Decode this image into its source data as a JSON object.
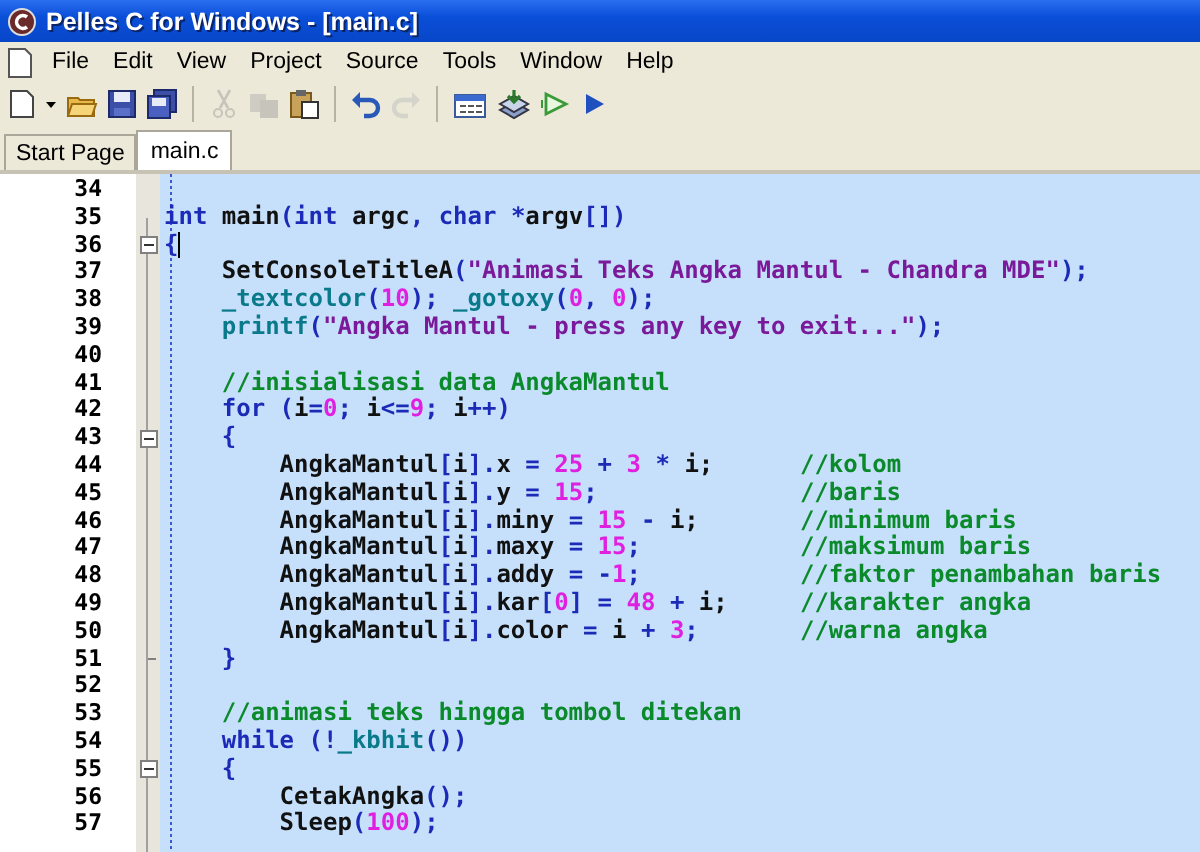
{
  "window": {
    "title": "Pelles C for Windows - [main.c]"
  },
  "menu": [
    {
      "label": "File"
    },
    {
      "label": "Edit"
    },
    {
      "label": "View"
    },
    {
      "label": "Project"
    },
    {
      "label": "Source"
    },
    {
      "label": "Tools"
    },
    {
      "label": "Window"
    },
    {
      "label": "Help"
    }
  ],
  "toolbar": [
    {
      "kind": "new",
      "disabled": false
    },
    {
      "kind": "dropdown",
      "disabled": false
    },
    {
      "kind": "open",
      "disabled": false
    },
    {
      "kind": "save",
      "disabled": false
    },
    {
      "kind": "saveall",
      "disabled": false
    },
    {
      "kind": "sep"
    },
    {
      "kind": "cut",
      "disabled": true
    },
    {
      "kind": "copy",
      "disabled": true
    },
    {
      "kind": "paste",
      "disabled": false
    },
    {
      "kind": "sep"
    },
    {
      "kind": "undo",
      "disabled": false
    },
    {
      "kind": "redo",
      "disabled": true
    },
    {
      "kind": "sep"
    },
    {
      "kind": "compile",
      "disabled": false
    },
    {
      "kind": "build",
      "disabled": false
    },
    {
      "kind": "run",
      "disabled": false
    },
    {
      "kind": "go",
      "disabled": false
    }
  ],
  "tabs": [
    {
      "label": "Start Page",
      "selected": false
    },
    {
      "label": "main.c",
      "selected": true
    }
  ],
  "editor": {
    "lines": [
      {
        "number": "34",
        "fold_start": false,
        "fold_end": false,
        "caret": false
      },
      {
        "number": "35",
        "fold_start": false,
        "fold_end": false,
        "caret": false,
        "tokens": [
          {
            "kind": "kw",
            "text": "int"
          },
          {
            "kind": "id",
            "text": " main"
          },
          {
            "kind": "op",
            "text": "("
          },
          {
            "kind": "kw",
            "text": "int"
          },
          {
            "kind": "id",
            "text": " argc"
          },
          {
            "kind": "op",
            "text": ", "
          },
          {
            "kind": "kw",
            "text": "char"
          },
          {
            "kind": "op",
            "text": " *"
          },
          {
            "kind": "id",
            "text": "argv"
          },
          {
            "kind": "op",
            "text": "[])"
          }
        ]
      },
      {
        "number": "36",
        "fold_start": true,
        "fold_end": false,
        "caret": true,
        "tokens": [
          {
            "kind": "op",
            "text": "{"
          }
        ]
      },
      {
        "number": "37",
        "fold_start": false,
        "fold_end": false,
        "caret": false,
        "tokens": [
          {
            "kind": "id",
            "text": "    SetConsoleTitleA"
          },
          {
            "kind": "op",
            "text": "("
          },
          {
            "kind": "str",
            "text": "\"Animasi Teks Angka Mantul - Chandra MDE\""
          },
          {
            "kind": "op",
            "text": ");"
          }
        ]
      },
      {
        "number": "38",
        "fold_start": false,
        "fold_end": false,
        "caret": false,
        "tokens": [
          {
            "kind": "fn",
            "text": "    _textcolor"
          },
          {
            "kind": "op",
            "text": "("
          },
          {
            "kind": "num",
            "text": "10"
          },
          {
            "kind": "op",
            "text": "); "
          },
          {
            "kind": "fn",
            "text": "_gotoxy"
          },
          {
            "kind": "op",
            "text": "("
          },
          {
            "kind": "num",
            "text": "0"
          },
          {
            "kind": "op",
            "text": ", "
          },
          {
            "kind": "num",
            "text": "0"
          },
          {
            "kind": "op",
            "text": ");"
          }
        ]
      },
      {
        "number": "39",
        "fold_start": false,
        "fold_end": false,
        "caret": false,
        "tokens": [
          {
            "kind": "fn",
            "text": "    printf"
          },
          {
            "kind": "op",
            "text": "("
          },
          {
            "kind": "str",
            "text": "\"Angka Mantul - press any key to exit...\""
          },
          {
            "kind": "op",
            "text": ");"
          }
        ]
      },
      {
        "number": "40",
        "fold_start": false,
        "fold_end": false,
        "caret": false
      },
      {
        "number": "41",
        "fold_start": false,
        "fold_end": false,
        "caret": false,
        "tokens": [
          {
            "kind": "cm",
            "text": "    //inisialisasi data AngkaMantul"
          }
        ]
      },
      {
        "number": "42",
        "fold_start": false,
        "fold_end": false,
        "caret": false,
        "tokens": [
          {
            "kind": "kw",
            "text": "    for"
          },
          {
            "kind": "op",
            "text": " ("
          },
          {
            "kind": "id",
            "text": "i"
          },
          {
            "kind": "op",
            "text": "="
          },
          {
            "kind": "num",
            "text": "0"
          },
          {
            "kind": "op",
            "text": "; "
          },
          {
            "kind": "id",
            "text": "i"
          },
          {
            "kind": "op",
            "text": "<="
          },
          {
            "kind": "num",
            "text": "9"
          },
          {
            "kind": "op",
            "text": "; "
          },
          {
            "kind": "id",
            "text": "i"
          },
          {
            "kind": "op",
            "text": "++)"
          }
        ]
      },
      {
        "number": "43",
        "fold_start": true,
        "fold_end": false,
        "caret": false,
        "tokens": [
          {
            "kind": "op",
            "text": "    {"
          }
        ]
      },
      {
        "number": "44",
        "fold_start": false,
        "fold_end": false,
        "caret": false,
        "tokens": [
          {
            "kind": "id",
            "text": "        AngkaMantul"
          },
          {
            "kind": "op",
            "text": "["
          },
          {
            "kind": "id",
            "text": "i"
          },
          {
            "kind": "op",
            "text": "]."
          },
          {
            "kind": "id",
            "text": "x"
          },
          {
            "kind": "op",
            "text": " = "
          },
          {
            "kind": "num",
            "text": "25"
          },
          {
            "kind": "op",
            "text": " + "
          },
          {
            "kind": "num",
            "text": "3"
          },
          {
            "kind": "op",
            "text": " * "
          },
          {
            "kind": "id",
            "text": "i;      "
          },
          {
            "kind": "cm",
            "text": "//kolom"
          }
        ]
      },
      {
        "number": "45",
        "fold_start": false,
        "fold_end": false,
        "caret": false,
        "tokens": [
          {
            "kind": "id",
            "text": "        AngkaMantul"
          },
          {
            "kind": "op",
            "text": "["
          },
          {
            "kind": "id",
            "text": "i"
          },
          {
            "kind": "op",
            "text": "]."
          },
          {
            "kind": "id",
            "text": "y"
          },
          {
            "kind": "op",
            "text": " = "
          },
          {
            "kind": "num",
            "text": "15"
          },
          {
            "kind": "op",
            "text": ";              "
          },
          {
            "kind": "cm",
            "text": "//baris"
          }
        ]
      },
      {
        "number": "46",
        "fold_start": false,
        "fold_end": false,
        "caret": false,
        "tokens": [
          {
            "kind": "id",
            "text": "        AngkaMantul"
          },
          {
            "kind": "op",
            "text": "["
          },
          {
            "kind": "id",
            "text": "i"
          },
          {
            "kind": "op",
            "text": "]."
          },
          {
            "kind": "id",
            "text": "miny"
          },
          {
            "kind": "op",
            "text": " = "
          },
          {
            "kind": "num",
            "text": "15"
          },
          {
            "kind": "op",
            "text": " - "
          },
          {
            "kind": "id",
            "text": "i;       "
          },
          {
            "kind": "cm",
            "text": "//minimum baris"
          }
        ]
      },
      {
        "number": "47",
        "fold_start": false,
        "fold_end": false,
        "caret": false,
        "tokens": [
          {
            "kind": "id",
            "text": "        AngkaMantul"
          },
          {
            "kind": "op",
            "text": "["
          },
          {
            "kind": "id",
            "text": "i"
          },
          {
            "kind": "op",
            "text": "]."
          },
          {
            "kind": "id",
            "text": "maxy"
          },
          {
            "kind": "op",
            "text": " = "
          },
          {
            "kind": "num",
            "text": "15"
          },
          {
            "kind": "op",
            "text": ";           "
          },
          {
            "kind": "cm",
            "text": "//maksimum baris"
          }
        ]
      },
      {
        "number": "48",
        "fold_start": false,
        "fold_end": false,
        "caret": false,
        "tokens": [
          {
            "kind": "id",
            "text": "        AngkaMantul"
          },
          {
            "kind": "op",
            "text": "["
          },
          {
            "kind": "id",
            "text": "i"
          },
          {
            "kind": "op",
            "text": "]."
          },
          {
            "kind": "id",
            "text": "addy"
          },
          {
            "kind": "op",
            "text": " = -"
          },
          {
            "kind": "num",
            "text": "1"
          },
          {
            "kind": "op",
            "text": ";           "
          },
          {
            "kind": "cm",
            "text": "//faktor penambahan baris"
          }
        ]
      },
      {
        "number": "49",
        "fold_start": false,
        "fold_end": false,
        "caret": false,
        "tokens": [
          {
            "kind": "id",
            "text": "        AngkaMantul"
          },
          {
            "kind": "op",
            "text": "["
          },
          {
            "kind": "id",
            "text": "i"
          },
          {
            "kind": "op",
            "text": "]."
          },
          {
            "kind": "id",
            "text": "kar"
          },
          {
            "kind": "op",
            "text": "["
          },
          {
            "kind": "num",
            "text": "0"
          },
          {
            "kind": "op",
            "text": "] = "
          },
          {
            "kind": "num",
            "text": "48"
          },
          {
            "kind": "op",
            "text": " + "
          },
          {
            "kind": "id",
            "text": "i;     "
          },
          {
            "kind": "cm",
            "text": "//karakter angka"
          }
        ]
      },
      {
        "number": "50",
        "fold_start": false,
        "fold_end": false,
        "caret": false,
        "tokens": [
          {
            "kind": "id",
            "text": "        AngkaMantul"
          },
          {
            "kind": "op",
            "text": "["
          },
          {
            "kind": "id",
            "text": "i"
          },
          {
            "kind": "op",
            "text": "]."
          },
          {
            "kind": "id",
            "text": "color"
          },
          {
            "kind": "op",
            "text": " = "
          },
          {
            "kind": "id",
            "text": "i"
          },
          {
            "kind": "op",
            "text": " + "
          },
          {
            "kind": "num",
            "text": "3"
          },
          {
            "kind": "op",
            "text": ";       "
          },
          {
            "kind": "cm",
            "text": "//warna angka"
          }
        ]
      },
      {
        "number": "51",
        "fold_start": false,
        "fold_end": true,
        "caret": false,
        "tokens": [
          {
            "kind": "op",
            "text": "    }"
          }
        ]
      },
      {
        "number": "52",
        "fold_start": false,
        "fold_end": false,
        "caret": false
      },
      {
        "number": "53",
        "fold_start": false,
        "fold_end": false,
        "caret": false,
        "tokens": [
          {
            "kind": "cm",
            "text": "    //animasi teks hingga tombol ditekan"
          }
        ]
      },
      {
        "number": "54",
        "fold_start": false,
        "fold_end": false,
        "caret": false,
        "tokens": [
          {
            "kind": "kw",
            "text": "    while"
          },
          {
            "kind": "op",
            "text": " (!"
          },
          {
            "kind": "fn",
            "text": "_kbhit"
          },
          {
            "kind": "op",
            "text": "())"
          }
        ]
      },
      {
        "number": "55",
        "fold_start": true,
        "fold_end": false,
        "caret": false,
        "tokens": [
          {
            "kind": "op",
            "text": "    {"
          }
        ]
      },
      {
        "number": "56",
        "fold_start": false,
        "fold_end": false,
        "caret": false,
        "tokens": [
          {
            "kind": "id",
            "text": "        CetakAngka"
          },
          {
            "kind": "op",
            "text": "();"
          }
        ]
      },
      {
        "number": "57",
        "fold_start": false,
        "fold_end": false,
        "caret": false,
        "tokens": [
          {
            "kind": "id",
            "text": "        Sleep"
          },
          {
            "kind": "op",
            "text": "("
          },
          {
            "kind": "num",
            "text": "100"
          },
          {
            "kind": "op",
            "text": ");"
          }
        ]
      }
    ]
  }
}
